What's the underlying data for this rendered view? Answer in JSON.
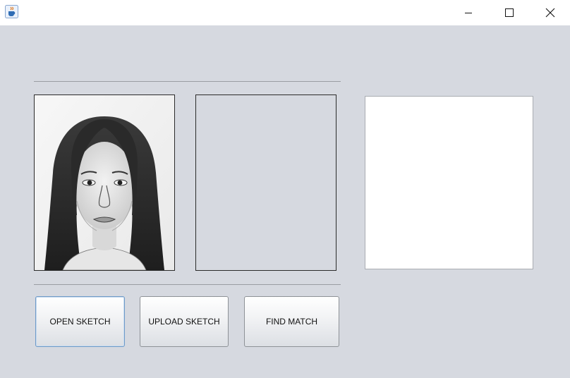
{
  "window": {
    "app_icon": "java-cup-icon",
    "controls": {
      "minimize": "minimize-icon",
      "maximize": "maximize-icon",
      "close": "close-icon"
    }
  },
  "panels": {
    "sketch_image": "pencil sketch portrait",
    "result_image": "",
    "output_area": ""
  },
  "buttons": {
    "open_sketch": "OPEN SKETCH",
    "upload_sketch": "UPLOAD SKETCH",
    "find_match": "FIND MATCH"
  },
  "colors": {
    "background": "#d6d9e0",
    "titlebar": "#ffffff",
    "focus_border": "#6f9ac8"
  }
}
